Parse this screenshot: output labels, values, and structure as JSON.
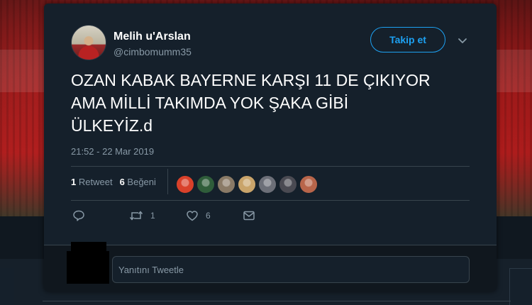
{
  "user": {
    "display_name": "Melih u'Arslan",
    "handle": "@cimbomumm35"
  },
  "follow_button_label": "Takip et",
  "tweet": {
    "text": "OZAN KABAK BAYERNE KARŞI 11 DE ÇIKIYOR\nAMA MİLLİ TAKIMDA YOK ŞAKA GİBİ\nÜLKEYİZ.d",
    "timestamp": "21:52 - 22 Mar 2019"
  },
  "stats": {
    "retweet_count": "1",
    "retweet_label": "Retweet",
    "like_count": "6",
    "like_label": "Beğeni"
  },
  "likers": [
    {
      "name": "liker-1",
      "color": "#d9412a"
    },
    {
      "name": "liker-2",
      "color": "#2f5d3a"
    },
    {
      "name": "liker-3",
      "color": "#8a7a66"
    },
    {
      "name": "liker-4",
      "color": "#c9a46a"
    },
    {
      "name": "liker-5",
      "color": "#6c6f78"
    },
    {
      "name": "liker-6",
      "color": "#4a4a52"
    },
    {
      "name": "liker-7",
      "color": "#b8654a"
    }
  ],
  "actions": {
    "reply_icon": "reply-icon",
    "retweet_count": "1",
    "like_count": "6",
    "dm_icon": "envelope-icon"
  },
  "reply": {
    "placeholder": "Yanıtını Tweetle"
  },
  "colors": {
    "accent": "#1da1f2",
    "background": "#15202b",
    "muted": "#8899a6"
  }
}
